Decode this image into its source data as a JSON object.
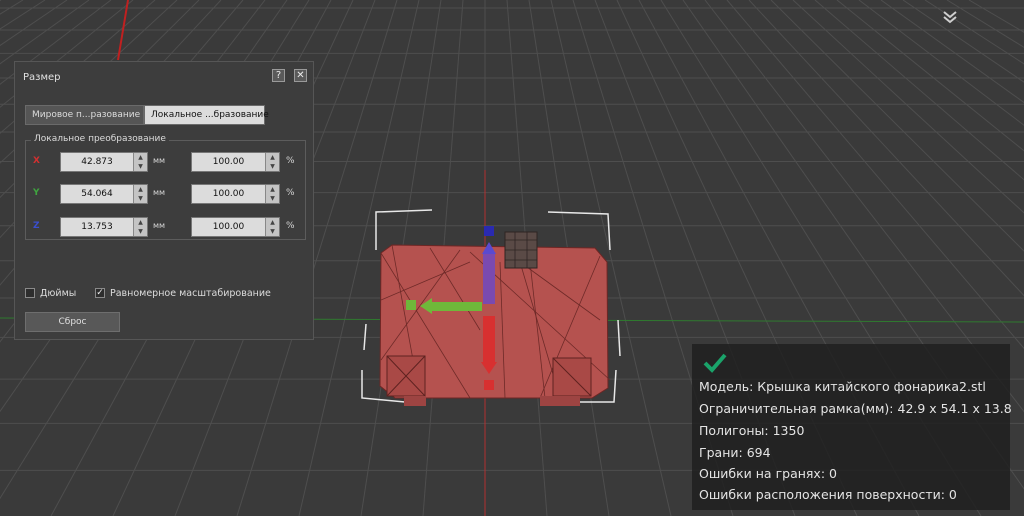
{
  "size_panel": {
    "title": "Размер",
    "help_label": "?",
    "close_label": "✕",
    "tabs": [
      {
        "label": "Мировое п...разование",
        "active": false
      },
      {
        "label": "Локальное ...бразование",
        "active": true
      }
    ],
    "group_title": "Локальное преобразование",
    "rows": [
      {
        "axis": "X",
        "axis_color": "#d23030",
        "size": "42.873",
        "size_unit": "мм",
        "percent": "100.00",
        "percent_unit": "%"
      },
      {
        "axis": "Y",
        "axis_color": "#3fa53f",
        "size": "54.064",
        "size_unit": "мм",
        "percent": "100.00",
        "percent_unit": "%"
      },
      {
        "axis": "Z",
        "axis_color": "#3a4fd0",
        "size": "13.753",
        "size_unit": "мм",
        "percent": "100.00",
        "percent_unit": "%"
      }
    ],
    "inches_label": "Дюймы",
    "inches_checked": false,
    "uniform_label": "Равномерное масштабирование",
    "uniform_checked": true,
    "reset_label": "Сброс"
  },
  "model_info": {
    "status_icon": "checkmark-icon",
    "status_color": "#1aa36a",
    "model": "Модель: Крышка китайского фонарика2.stl",
    "bounding_box": "Ограничительная рамка(мм): 42.9 x 54.1 x 13.8",
    "polygons": "Полигоны: 1350",
    "faces": "Грани: 694",
    "face_errors": "Ошибки на гранях: 0",
    "surface_errors": "Ошибки расположения поверхности: 0"
  },
  "viewport": {
    "background": "#3a3a3a",
    "grid_color": "#4c4c4c",
    "model_color": "#b5524f",
    "move_arrow_x_color": "#5c9a2e",
    "move_arrow_y_color": "#cc2e2e",
    "move_arrow_z_color": "#2a2ab0",
    "collapse_icon": "chevron-down-icon"
  }
}
